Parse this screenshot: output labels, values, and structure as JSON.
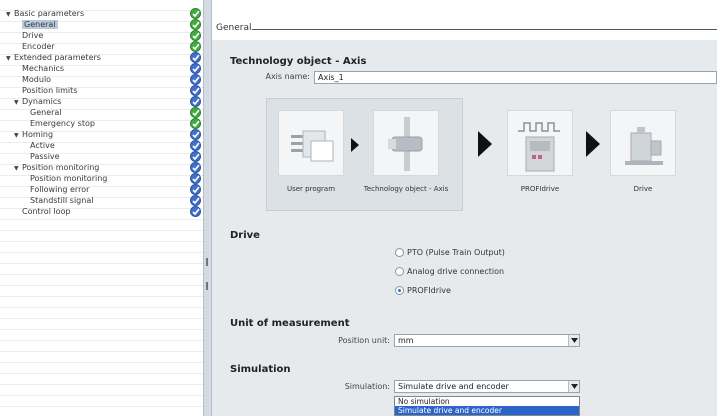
{
  "nav": {
    "items": [
      {
        "label": "Basic parameters",
        "level": 0,
        "arrow": "expanded",
        "selected": false
      },
      {
        "label": "General",
        "level": 1,
        "arrow": "",
        "selected": true
      },
      {
        "label": "Drive",
        "level": 1,
        "arrow": "",
        "selected": false
      },
      {
        "label": "Encoder",
        "level": 1,
        "arrow": "",
        "selected": false
      },
      {
        "label": "Extended parameters",
        "level": 0,
        "arrow": "expanded",
        "selected": false
      },
      {
        "label": "Mechanics",
        "level": 1,
        "arrow": "",
        "selected": false
      },
      {
        "label": "Modulo",
        "level": 1,
        "arrow": "",
        "selected": false
      },
      {
        "label": "Position limits",
        "level": 1,
        "arrow": "",
        "selected": false
      },
      {
        "label": "Dynamics",
        "level": 1,
        "arrow": "expanded",
        "selected": false
      },
      {
        "label": "General",
        "level": 2,
        "arrow": "",
        "selected": false
      },
      {
        "label": "Emergency stop",
        "level": 2,
        "arrow": "",
        "selected": false
      },
      {
        "label": "Homing",
        "level": 1,
        "arrow": "expanded",
        "selected": false
      },
      {
        "label": "Active",
        "level": 2,
        "arrow": "",
        "selected": false
      },
      {
        "label": "Passive",
        "level": 2,
        "arrow": "",
        "selected": false
      },
      {
        "label": "Position monitoring",
        "level": 1,
        "arrow": "expanded",
        "selected": false
      },
      {
        "label": "Position monitoring",
        "level": 2,
        "arrow": "",
        "selected": false
      },
      {
        "label": "Following error",
        "level": 2,
        "arrow": "",
        "selected": false
      },
      {
        "label": "Standstill signal",
        "level": 2,
        "arrow": "",
        "selected": false
      },
      {
        "label": "Control loop",
        "level": 1,
        "arrow": "",
        "selected": false
      }
    ],
    "status_icons": [
      "green-check",
      "green-check",
      "green-check",
      "green-check",
      "blue-check",
      "blue-check",
      "blue-check",
      "blue-check",
      "blue-check",
      "green-check",
      "green-check",
      "blue-check",
      "blue-check",
      "blue-check",
      "blue-check",
      "blue-check",
      "blue-check",
      "blue-check",
      "blue-check"
    ]
  },
  "colors": {
    "status_green": "#3fae3f",
    "status_blue": "#3f6fd0",
    "selection": "#b7c9dd",
    "dropdown_highlight": "#2d64c8"
  },
  "header": {
    "title": "General"
  },
  "technology_object": {
    "title": "Technology object - Axis",
    "axis_name_label": "Axis name:",
    "axis_name_value": "Axis_1"
  },
  "diagram": {
    "tiles": [
      {
        "label": "User program",
        "icon": "user-program-icon"
      },
      {
        "label": "Technology object - Axis",
        "icon": "technology-object-icon"
      },
      {
        "label": "PROFIdrive",
        "icon": "profidrive-icon"
      },
      {
        "label": "Drive",
        "icon": "drive-motor-icon"
      }
    ]
  },
  "drive": {
    "title": "Drive",
    "options": [
      {
        "label": "PTO (Pulse Train Output)",
        "checked": false
      },
      {
        "label": "Analog drive connection",
        "checked": false
      },
      {
        "label": "PROFIdrive",
        "checked": true
      }
    ]
  },
  "unit": {
    "title": "Unit of measurement",
    "position_unit_label": "Position unit:",
    "position_unit_value": "mm"
  },
  "simulation": {
    "title": "Simulation",
    "label": "Simulation:",
    "value": "Simulate drive and encoder",
    "options": [
      "No simulation",
      "Simulate drive and encoder"
    ],
    "highlighted_option": 1
  }
}
